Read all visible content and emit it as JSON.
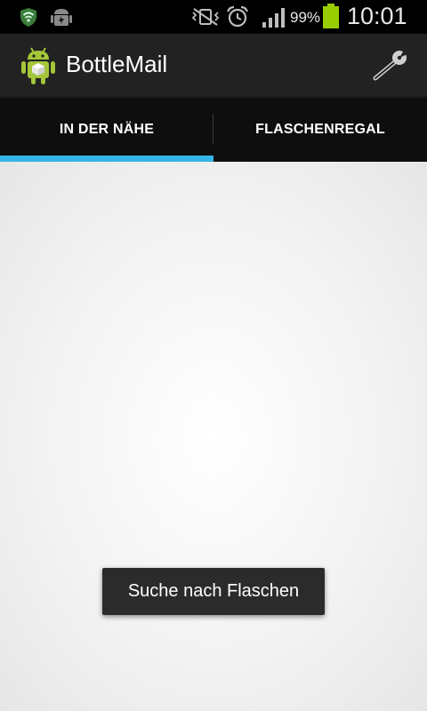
{
  "status_bar": {
    "battery_percent": "99%",
    "time": "10:01",
    "icons": [
      "shield-wifi-icon",
      "android-debug-icon",
      "mute-vibrate-icon",
      "alarm-icon",
      "signal-icon",
      "battery-icon"
    ],
    "battery_level": 0.99
  },
  "action_bar": {
    "title": "BottleMail",
    "app_icon": "android-app-icon",
    "action_icon": "wrench-icon"
  },
  "tabs": [
    {
      "label": "IN DER NÄHE",
      "selected": true
    },
    {
      "label": "FLASCHENREGAL",
      "selected": false
    }
  ],
  "toast": {
    "text": "Suche nach Flaschen"
  },
  "colors": {
    "accent": "#33b5e5",
    "action_bar": "#222222",
    "tab_bar": "#0e0e0e",
    "battery": "#99cc00",
    "app_icon_green": "#a4c639"
  }
}
